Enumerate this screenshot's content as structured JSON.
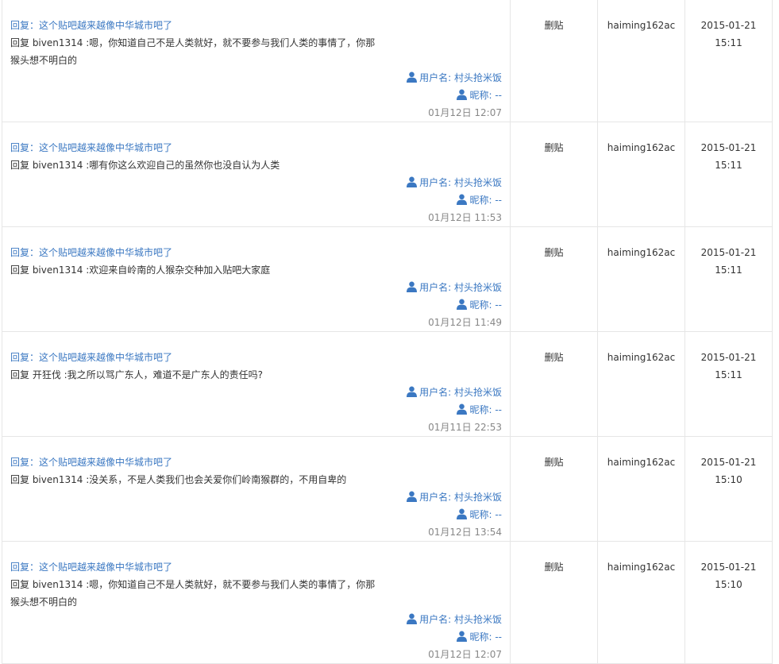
{
  "labels": {
    "username_prefix": "用户名:",
    "nickname_prefix": "昵称:"
  },
  "colors": {
    "link": "#3b78c2",
    "muted": "#888888",
    "border": "#e6e6e6"
  },
  "rows": [
    {
      "title": "回复：这个贴吧越来越像中华城市吧了",
      "body": "回复 biven1314 :嗯，你知道自己不是人类就好，就不要参与我们人类的事情了，你那猴头想不明白的",
      "username": "村头抢米饭",
      "nickname": "--",
      "date": "01月12日 12:07",
      "action": "删贴",
      "operator": "haiming162ac",
      "time_date": "2015-01-21",
      "time_clock": "15:11"
    },
    {
      "title": "回复：这个贴吧越来越像中华城市吧了",
      "body": "回复 biven1314 :哪有你这么欢迎自己的虽然你也没自认为人类",
      "username": "村头抢米饭",
      "nickname": "--",
      "date": "01月12日 11:53",
      "action": "删贴",
      "operator": "haiming162ac",
      "time_date": "2015-01-21",
      "time_clock": "15:11"
    },
    {
      "title": "回复：这个贴吧越来越像中华城市吧了",
      "body": "回复 biven1314 :欢迎来自岭南的人猴杂交种加入贴吧大家庭",
      "username": "村头抢米饭",
      "nickname": "--",
      "date": "01月12日 11:49",
      "action": "删贴",
      "operator": "haiming162ac",
      "time_date": "2015-01-21",
      "time_clock": "15:11"
    },
    {
      "title": "回复：这个贴吧越来越像中华城市吧了",
      "body": "回复 开狂伐 :我之所以骂广东人，难道不是广东人的责任吗?",
      "username": "村头抢米饭",
      "nickname": "--",
      "date": "01月11日 22:53",
      "action": "删贴",
      "operator": "haiming162ac",
      "time_date": "2015-01-21",
      "time_clock": "15:11"
    },
    {
      "title": "回复：这个贴吧越来越像中华城市吧了",
      "body": "回复 biven1314 :没关系，不是人类我们也会关爱你们岭南猴群的，不用自卑的",
      "username": "村头抢米饭",
      "nickname": "--",
      "date": "01月12日 13:54",
      "action": "删贴",
      "operator": "haiming162ac",
      "time_date": "2015-01-21",
      "time_clock": "15:10"
    },
    {
      "title": "回复：这个贴吧越来越像中华城市吧了",
      "body": "回复 biven1314 :嗯，你知道自己不是人类就好，就不要参与我们人类的事情了，你那猴头想不明白的",
      "username": "村头抢米饭",
      "nickname": "--",
      "date": "01月12日 12:07",
      "action": "删贴",
      "operator": "haiming162ac",
      "time_date": "2015-01-21",
      "time_clock": "15:10"
    }
  ]
}
